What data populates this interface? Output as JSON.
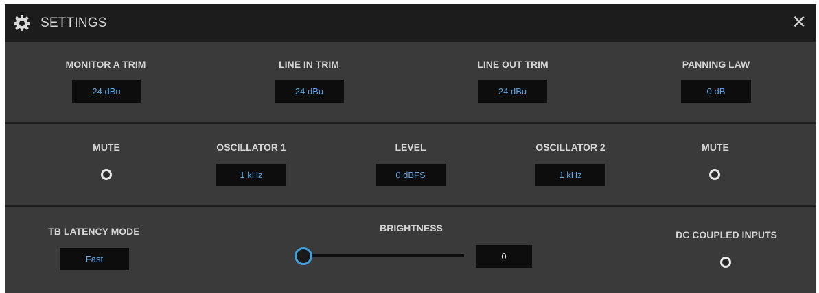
{
  "window": {
    "title": "SETTINGS",
    "close_glyph": "✕",
    "icon": "gear-icon",
    "close_icon": "close-icon"
  },
  "colors": {
    "background": "#3a3a3b",
    "titlebar": "#1c1c1d",
    "value_text": "#5aa6e6",
    "slider_accent": "#3fa0de"
  },
  "trims": [
    {
      "label": "MONITOR A TRIM",
      "value": "24 dBu"
    },
    {
      "label": "LINE IN TRIM",
      "value": "24 dBu"
    },
    {
      "label": "LINE OUT TRIM",
      "value": "24 dBu"
    },
    {
      "label": "PANNING LAW",
      "value": "0 dB"
    }
  ],
  "oscillator": {
    "mute1_label": "MUTE",
    "osc1_label": "OSCILLATOR 1",
    "osc1_value": "1 kHz",
    "level_label": "LEVEL",
    "level_value": "0 dBFS",
    "osc2_label": "OSCILLATOR 2",
    "osc2_value": "1 kHz",
    "mute2_label": "MUTE"
  },
  "bottom": {
    "latency_label": "TB LATENCY MODE",
    "latency_value": "Fast",
    "brightness_label": "BRIGHTNESS",
    "brightness_value": "0",
    "brightness_level": 0,
    "dc_label": "DC COUPLED INPUTS"
  }
}
